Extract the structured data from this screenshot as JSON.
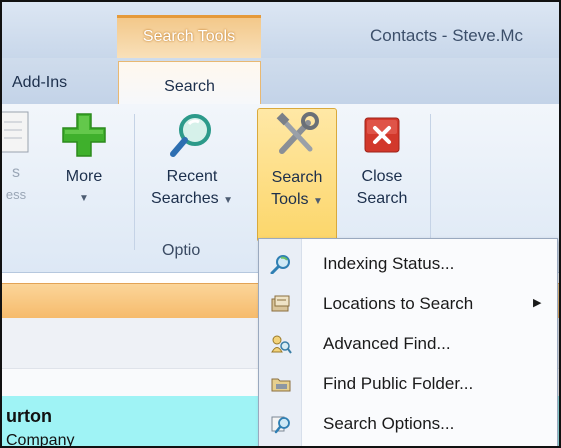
{
  "context_tab": {
    "label": "Search Tools"
  },
  "window": {
    "title": "Contacts - Steve.Mc"
  },
  "tabs": [
    {
      "label": "Add-Ins"
    },
    {
      "label": "Search"
    }
  ],
  "ribbon": {
    "partial_button": {
      "line1": "s",
      "line2": "ess"
    },
    "more": {
      "label": "More"
    },
    "recent_searches": {
      "line1": "Recent",
      "line2": "Searches"
    },
    "search_tools": {
      "line1": "Search",
      "line2": "Tools"
    },
    "close_search": {
      "line1": "Close",
      "line2": "Search"
    },
    "group_label": "Optio"
  },
  "menu": {
    "items": [
      {
        "label": "Indexing Status...",
        "icon": "indexing-status-icon",
        "submenu": false
      },
      {
        "label": "Locations to Search",
        "icon": "locations-icon",
        "submenu": true
      },
      {
        "label": "Advanced Find...",
        "icon": "advanced-find-icon",
        "submenu": false
      },
      {
        "label": "Find Public Folder...",
        "icon": "public-folder-icon",
        "submenu": false
      },
      {
        "label": "Search Options...",
        "icon": "search-options-icon",
        "submenu": false
      }
    ]
  },
  "contact": {
    "name": "urton",
    "company": "Company"
  },
  "colors": {
    "accent": "#f6bb6c",
    "highlight": "#fcd66a",
    "card": "#9ff3f5"
  }
}
